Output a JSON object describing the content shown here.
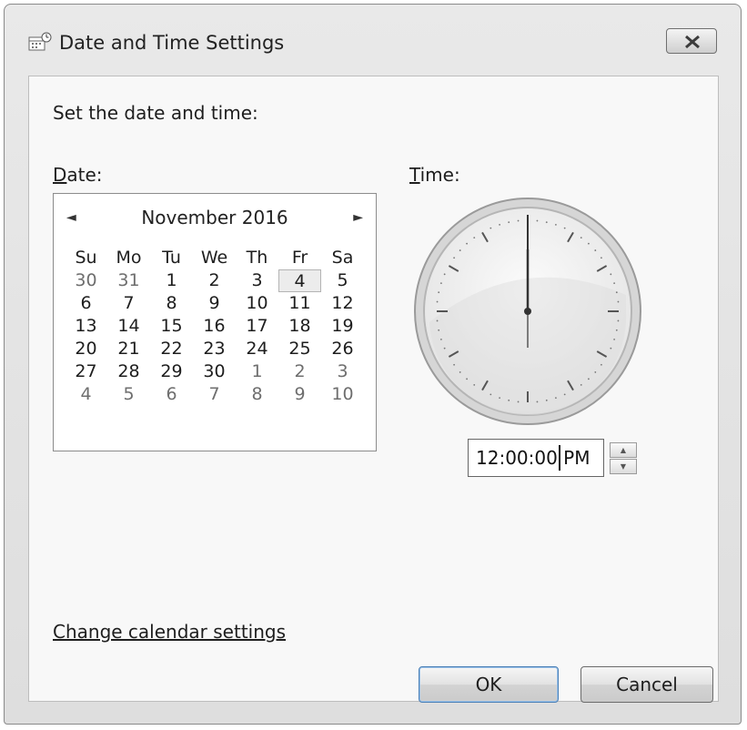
{
  "window": {
    "title": "Date and Time Settings"
  },
  "heading": "Set the date and time:",
  "date_label": {
    "mnemonic": "D",
    "rest": "ate:"
  },
  "time_label": {
    "mnemonic": "T",
    "rest": "ime:"
  },
  "calendar": {
    "month_year": "November 2016",
    "prev_symbol": "◄",
    "next_symbol": "►",
    "days_of_week": [
      "Su",
      "Mo",
      "Tu",
      "We",
      "Th",
      "Fr",
      "Sa"
    ],
    "weeks": [
      [
        "30",
        "31",
        "1",
        "2",
        "3",
        "4",
        "5"
      ],
      [
        "6",
        "7",
        "8",
        "9",
        "10",
        "11",
        "12"
      ],
      [
        "13",
        "14",
        "15",
        "16",
        "17",
        "18",
        "19"
      ],
      [
        "20",
        "21",
        "22",
        "23",
        "24",
        "25",
        "26"
      ],
      [
        "27",
        "28",
        "29",
        "30",
        "1",
        "2",
        "3"
      ],
      [
        "4",
        "5",
        "6",
        "7",
        "8",
        "9",
        "10"
      ]
    ],
    "selected_day": "4"
  },
  "clock": {
    "hour": 12,
    "minute": 0,
    "second": 0
  },
  "time_field": {
    "value": "12:00:00 PM"
  },
  "spin": {
    "up": "▲",
    "down": "▼"
  },
  "link": "Change calendar settings",
  "buttons": {
    "ok": "OK",
    "cancel": "Cancel"
  },
  "colors": {
    "ok_border": "#4a7fb5",
    "clock_face": "#f2f2f2"
  }
}
